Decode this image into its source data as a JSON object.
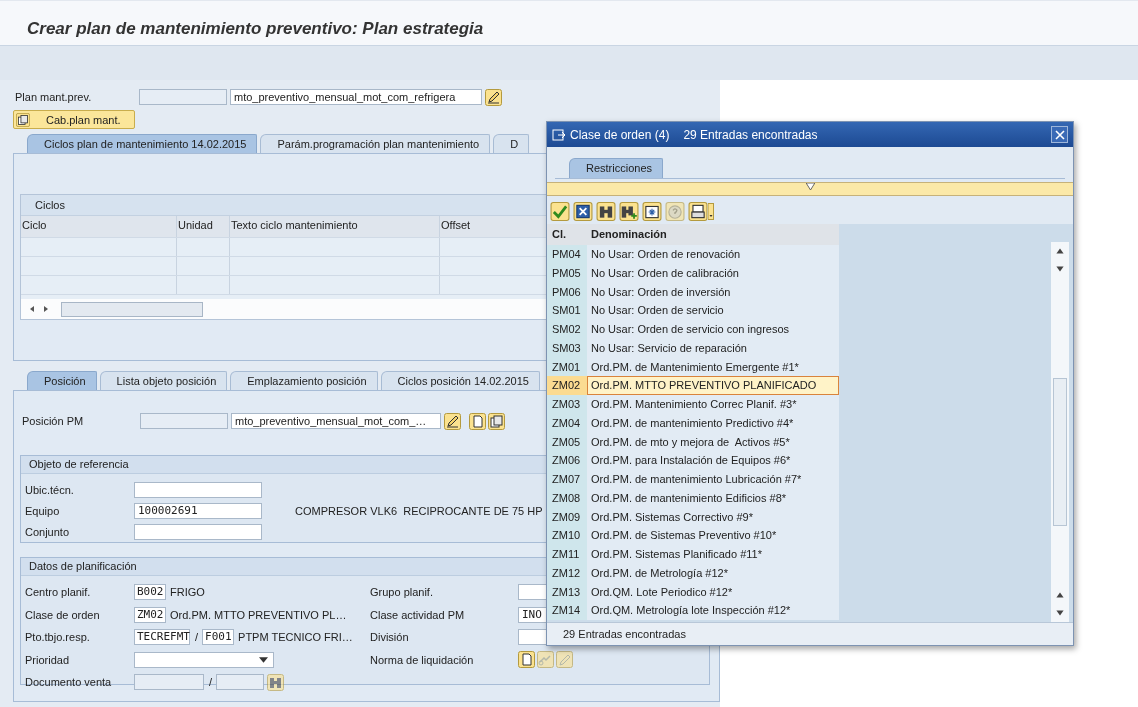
{
  "window": {
    "title": "Crear plan de mantenimiento preventivo: Plan estrategia"
  },
  "plan": {
    "label": "Plan mant.prev.",
    "description": "mto_preventivo_mensual_mot_com_refrigera"
  },
  "header_button": {
    "label": "Cab.plan mant."
  },
  "plan_tabs": [
    {
      "label": "Ciclos plan de mantenimiento 14.02.2015",
      "selected": true
    },
    {
      "label": "Parám.programación plan mantenimiento",
      "selected": false
    },
    {
      "label": "D",
      "selected": false
    }
  ],
  "cycles_table": {
    "title": "Ciclos",
    "columns": [
      "Ciclo",
      "Unidad",
      "Texto ciclo mantenimiento",
      "Offset"
    ]
  },
  "item_tabs": [
    {
      "label": "Posición",
      "selected": true
    },
    {
      "label": "Lista objeto posición",
      "selected": false
    },
    {
      "label": "Emplazamiento posición",
      "selected": false
    },
    {
      "label": "Ciclos posición 14.02.2015",
      "selected": false
    }
  ],
  "item": {
    "label": "Posición PM",
    "description": "mto_preventivo_mensual_mot_com_…"
  },
  "reference_object": {
    "title": "Objeto de referencia",
    "fields": [
      {
        "label": "Ubic.técn."
      },
      {
        "label": "Equipo",
        "value": "100002691",
        "description": "COMPRESOR VLK6  RECIPROCANTE DE 75 HP"
      },
      {
        "label": "Conjunto"
      }
    ]
  },
  "planning_data": {
    "title": "Datos de planificación",
    "left": [
      {
        "label": "Centro planif.",
        "kind": "code",
        "value": "B002",
        "description": "FRIGO"
      },
      {
        "label": "Clase de orden",
        "kind": "code",
        "value": "ZM02",
        "description": "Ord.PM. MTTO PREVENTIVO PL…"
      },
      {
        "label": "Pto.tbjo.resp.",
        "kind": "pair",
        "value": "TECREFMT",
        "separator": "/",
        "value_2": "F001",
        "description": "PTPM TECNICO FRI…"
      },
      {
        "label": "Prioridad",
        "kind": "dropdown"
      },
      {
        "label": "Documento venta",
        "kind": "lookup",
        "separator": "/"
      }
    ],
    "right": [
      {
        "label": "Grupo planif.",
        "kind": "field"
      },
      {
        "label": "Clase actividad PM",
        "kind": "field",
        "value": "INO"
      },
      {
        "label": "División",
        "kind": "field"
      },
      {
        "label": "Norma de liquidación",
        "kind": "buttons"
      }
    ]
  },
  "popup": {
    "title": "Clase de orden (4)",
    "subtitle": "29 Entradas encontradas",
    "tabs": [
      {
        "label": "Restricciones",
        "selected": true
      }
    ],
    "columns": [
      "Cl.",
      "Denominación"
    ],
    "rows": [
      {
        "code": "PM04",
        "text": "No Usar: Orden de renovación",
        "selected": false
      },
      {
        "code": "PM05",
        "text": "No Usar: Orden de calibración",
        "selected": false
      },
      {
        "code": "PM06",
        "text": "No Usar: Orden de inversión",
        "selected": false
      },
      {
        "code": "SM01",
        "text": "No Usar: Orden de servicio",
        "selected": false
      },
      {
        "code": "SM02",
        "text": "No Usar: Orden de servicio con ingresos",
        "selected": false
      },
      {
        "code": "SM03",
        "text": "No Usar: Servicio de reparación",
        "selected": false
      },
      {
        "code": "ZM01",
        "text": "Ord.PM. de Mantenimiento Emergente #1*",
        "selected": false
      },
      {
        "code": "ZM02",
        "text": "Ord.PM. MTTO PREVENTIVO PLANIFICADO",
        "selected": true
      },
      {
        "code": "ZM03",
        "text": "Ord.PM. Mantenimiento Correc Planif. #3*",
        "selected": false
      },
      {
        "code": "ZM04",
        "text": "Ord.PM. de mantenimiento Predictivo #4*",
        "selected": false
      },
      {
        "code": "ZM05",
        "text": "Ord.PM. de mto y mejora de  Activos #5*",
        "selected": false
      },
      {
        "code": "ZM06",
        "text": "Ord.PM. para Instalación de Equipos #6*",
        "selected": false
      },
      {
        "code": "ZM07",
        "text": "Ord.PM. de mantenimiento Lubricación #7*",
        "selected": false
      },
      {
        "code": "ZM08",
        "text": "Ord.PM. de mantenimiento Edificios #8*",
        "selected": false
      },
      {
        "code": "ZM09",
        "text": "Ord.PM. Sistemas Correctivo #9*",
        "selected": false
      },
      {
        "code": "ZM10",
        "text": "Ord.PM. de Sistemas Preventivo #10*",
        "selected": false
      },
      {
        "code": "ZM11",
        "text": "Ord.PM. Sistemas Planificado #11*",
        "selected": false
      },
      {
        "code": "ZM12",
        "text": "Ord.PM. de Metrología #12*",
        "selected": false
      },
      {
        "code": "ZM13",
        "text": "Ord.QM. Lote Periodico #12*",
        "selected": false
      },
      {
        "code": "ZM14",
        "text": "Ord.QM. Metrología lote Inspección #12*",
        "selected": false
      }
    ],
    "status": "29 Entradas encontradas"
  }
}
